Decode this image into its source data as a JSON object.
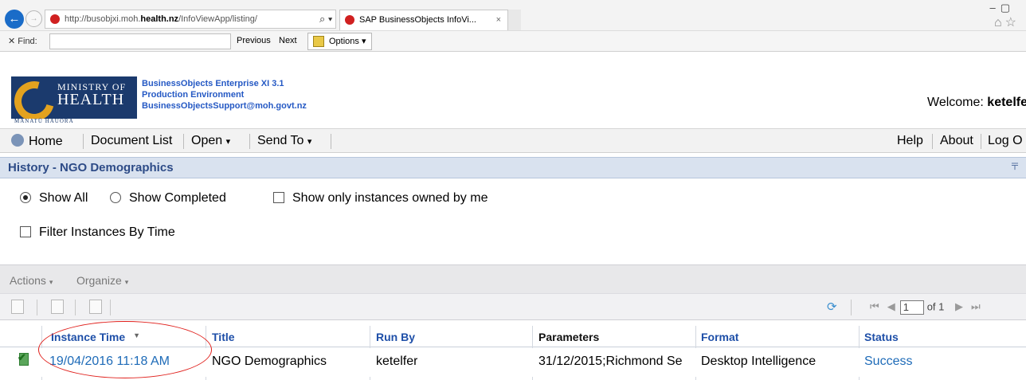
{
  "browser": {
    "address_prefix": "http://busobjxi.moh.",
    "address_domain": "health.nz",
    "address_path": "/InfoViewApp/listing/",
    "tab_title": "SAP BusinessObjects InfoVi...",
    "find_label": "Find:",
    "find_value": "",
    "find_previous": "Previous",
    "find_next": "Next",
    "find_options": "Options"
  },
  "ministry": {
    "logo_line1": "MINISTRY OF",
    "logo_line2": "HEALTH",
    "logo_line3": "MANATŪ HAUORA",
    "line1": "BusinessObjects Enterprise XI 3.1",
    "line2": "Production Environment",
    "line3": "BusinessObjectsSupport@moh.govt.nz",
    "welcome_label": "Welcome:",
    "welcome_user": "ketelfe"
  },
  "toolbar": {
    "home": "Home",
    "document_list": "Document List",
    "open": "Open",
    "send_to": "Send To",
    "help": "Help",
    "about": "About",
    "log_out": "Log O"
  },
  "history": {
    "title": "History - NGO Demographics",
    "show_all": "Show All",
    "show_completed": "Show Completed",
    "owned_by_me": "Show only instances owned by me",
    "filter_by_time": "Filter Instances By Time",
    "show_all_selected": true,
    "actions": "Actions",
    "organize": "Organize",
    "page_value": "1",
    "page_of": "of 1"
  },
  "table": {
    "columns": [
      "Instance Time",
      "Title",
      "Run By",
      "Parameters",
      "Format",
      "Status"
    ],
    "rows": [
      {
        "instance_time": "19/04/2016 11:18 AM",
        "title": "NGO Demographics",
        "run_by": "ketelfer",
        "parameters": "31/12/2015;Richmond Se",
        "format": "Desktop Intelligence",
        "status": "Success"
      }
    ]
  },
  "colors": {
    "accent_blue": "#1e4fa8",
    "link_blue": "#1e6bb8",
    "history_bar": "#d9e2ef",
    "annotation_red": "#e0201c"
  }
}
